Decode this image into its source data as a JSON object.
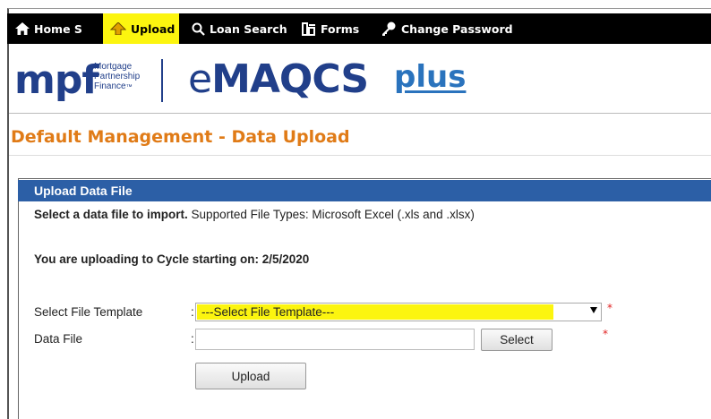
{
  "nav": {
    "items": [
      {
        "label": "Home S",
        "icon": "home-icon"
      },
      {
        "label": "Upload",
        "icon": "upload-icon",
        "highlighted": true
      },
      {
        "label": "Loan Search",
        "icon": "search-icon"
      },
      {
        "label": "Forms",
        "icon": "forms-icon"
      },
      {
        "label": "Change Password",
        "icon": "key-icon"
      }
    ]
  },
  "logo": {
    "mpf": "mpf",
    "mpf_line1": "Mortgage",
    "mpf_line2": "Partnership",
    "mpf_line3": "Finance",
    "tm": "™",
    "emaqcs_e": "e",
    "emaqcs_rest": "MAQCS",
    "plus": "plus"
  },
  "page": {
    "title": "Default Management - Data Upload"
  },
  "panel": {
    "header": "Upload Data File",
    "instruction_bold": "Select a data file to import.",
    "instruction_rest": " Supported File Types: Microsoft Excel (.xls and .xlsx)",
    "cycle_text": "You are uploading to Cycle starting on: 2/5/2020"
  },
  "form": {
    "template_label": "Select File Template",
    "template_colon": ":",
    "template_value": "---Select File Template---",
    "datafile_label": "Data File",
    "datafile_colon": ":",
    "datafile_value": "",
    "select_button": "Select",
    "upload_button": "Upload",
    "required_marker": "*"
  },
  "colors": {
    "nav_bg": "#000000",
    "highlight": "#fcf50f",
    "title_orange": "#e07b17",
    "panel_header_blue": "#2c5fa6",
    "brand_blue": "#213f8a",
    "plus_blue": "#2a73bd",
    "required_red": "#e02020"
  }
}
